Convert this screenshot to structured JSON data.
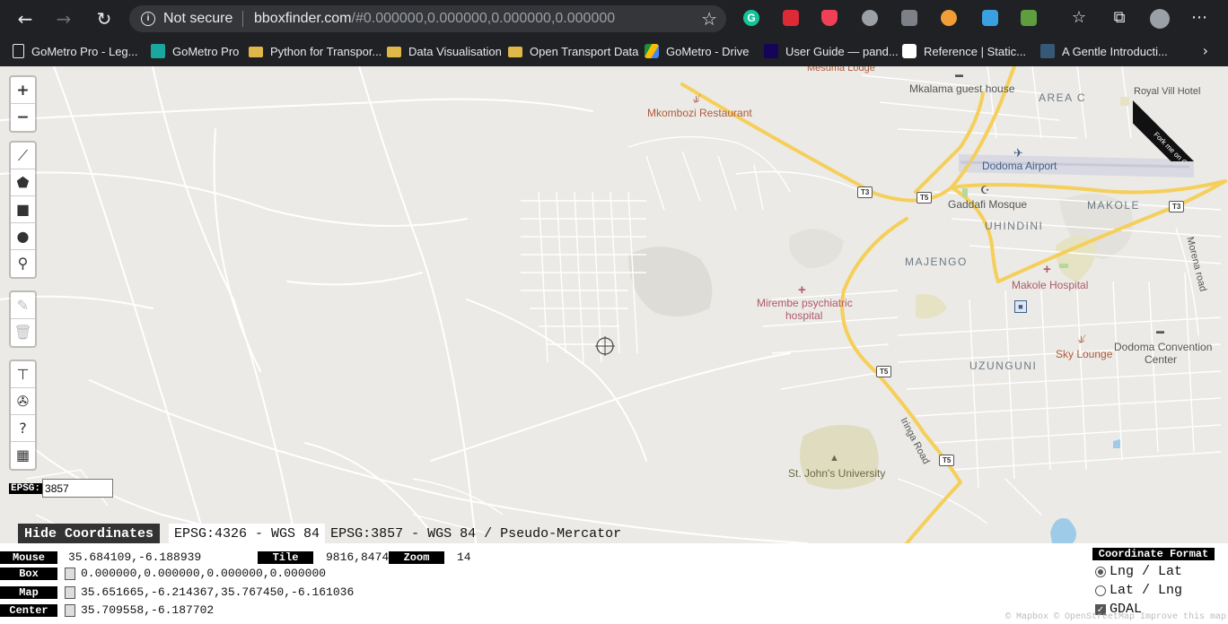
{
  "browser": {
    "not_secure_label": "Not secure",
    "url_host": "bboxfinder.com",
    "url_rest": "/#0.000000,0.000000,0.000000,0.000000",
    "extensions": {
      "grammarly": "G"
    }
  },
  "bookmarks": [
    {
      "label": "GoMetro Pro - Leg...",
      "icon": "page-icon"
    },
    {
      "label": "GoMetro Pro",
      "icon": "gometro-icon"
    },
    {
      "label": "Python for Transpor...",
      "icon": "folder-icon"
    },
    {
      "label": "Data Visualisation",
      "icon": "folder-icon"
    },
    {
      "label": "Open Transport Data",
      "icon": "folder-icon"
    },
    {
      "label": "GoMetro - Drive",
      "icon": "drive-icon"
    },
    {
      "label": "User Guide — pand...",
      "icon": "pandas-icon"
    },
    {
      "label": "Reference | Static...",
      "icon": "google-icon"
    },
    {
      "label": "A Gentle Introducti...",
      "icon": "tds-icon"
    }
  ],
  "map": {
    "labels": {
      "mesuma_lodge": "Mesuma Lodge",
      "mkalama": "Mkalama guest house",
      "area_c": "AREA C",
      "royal": "Royal Vill  Hotel",
      "mkombozi": "Mkombozi Restaurant",
      "airport": "Dodoma Airport",
      "gaddafi": "Gaddafi Mosque",
      "uhindini": "UHINDINI",
      "makole": "MAKOLE",
      "majengo": "MAJENGO",
      "makole_hospital": "Makole Hospital",
      "mirembe_1": "Mirembe psychiatric",
      "mirembe_2": "hospital",
      "sky_lounge": "Sky Lounge",
      "convention_1": "Dodoma Convention",
      "convention_2": "Center",
      "uzunguni": "UZUNGUNI",
      "iringa_road": "Iringa Road",
      "morena_road": "Morena road",
      "st_johns": "St. John's University"
    },
    "shields": {
      "t3_a": "T3",
      "t5_a": "T5",
      "t3_b": "T3",
      "t5_b": "T5",
      "t5_c": "T5",
      "t5_d": "T5"
    },
    "ribbon": "Fork me on GitHub",
    "colors": {
      "road_major": "#f5cf5a",
      "road_minor": "#ffffff",
      "background": "#ebeae6",
      "water": "#9dcbe8",
      "campus": "#e0dcc0"
    }
  },
  "controls": {
    "zoom_in": "+",
    "zoom_out": "−",
    "epsg_label": "EPSG:",
    "epsg_value": "3857"
  },
  "coord_tabs": {
    "hide": "Hide Coordinates",
    "wgs84": "EPSG:4326 - WGS 84",
    "mercator": "EPSG:3857 - WGS 84 / Pseudo-Mercator"
  },
  "coords": {
    "mouse_label": "Mouse",
    "mouse_value": "35.684109,-6.188939",
    "tile_label": "Tile",
    "tile_value": "9816,8474",
    "zoom_label": "Zoom",
    "zoom_value": "14",
    "box_label": "Box",
    "box_value": "0.000000,0.000000,0.000000,0.000000",
    "map_label": "Map",
    "map_value": "35.651665,-6.214367,35.767450,-6.161036",
    "center_label": "Center",
    "center_value": "35.709558,-6.187702"
  },
  "format": {
    "title": "Coordinate Format",
    "lnglat": "Lng / Lat",
    "latlng": "Lat / Lng",
    "gdal": "GDAL",
    "selected": "Lng / Lat",
    "gdal_checked": true
  },
  "attribution": "© Mapbox © OpenStreetMap Improve this map"
}
